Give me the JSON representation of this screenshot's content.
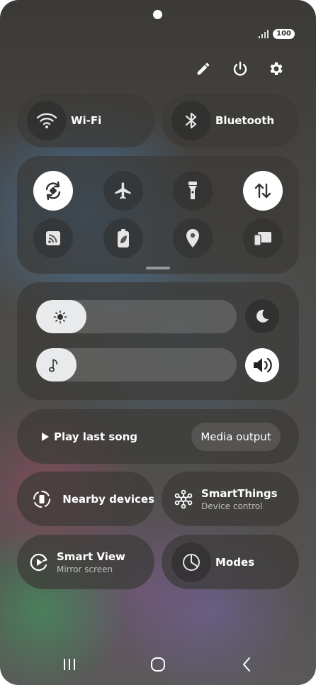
{
  "status": {
    "battery": "100"
  },
  "top_actions": [
    "edit-icon",
    "power-icon",
    "gear-icon"
  ],
  "wifi": {
    "label": "Wi-Fi"
  },
  "bluetooth": {
    "label": "Bluetooth"
  },
  "quick_toggles": [
    {
      "icon": "auto-rotate-icon",
      "active": true
    },
    {
      "icon": "airplane-icon",
      "active": false
    },
    {
      "icon": "flashlight-icon",
      "active": false
    },
    {
      "icon": "mobile-data-icon",
      "active": true
    },
    {
      "icon": "cast-icon",
      "active": false
    },
    {
      "icon": "power-saving-icon",
      "active": false
    },
    {
      "icon": "location-icon",
      "active": false
    },
    {
      "icon": "link-to-windows-icon",
      "active": false
    }
  ],
  "brightness": {
    "level": 0.25,
    "icon": "sun-icon"
  },
  "volume": {
    "level": 0.2,
    "icon": "music-note-icon"
  },
  "night_mode": {
    "icon": "moon-icon"
  },
  "sound_mode": {
    "icon": "speaker-icon"
  },
  "media": {
    "play_label": "Play last song",
    "output_label": "Media output"
  },
  "nearby": {
    "label": "Nearby devices"
  },
  "smartthings": {
    "label": "SmartThings",
    "sublabel": "Device control"
  },
  "smartview": {
    "label": "Smart View",
    "sublabel": "Mirror screen"
  },
  "modes": {
    "label": "Modes"
  },
  "navbar": [
    "recents-icon",
    "home-icon",
    "back-icon"
  ]
}
